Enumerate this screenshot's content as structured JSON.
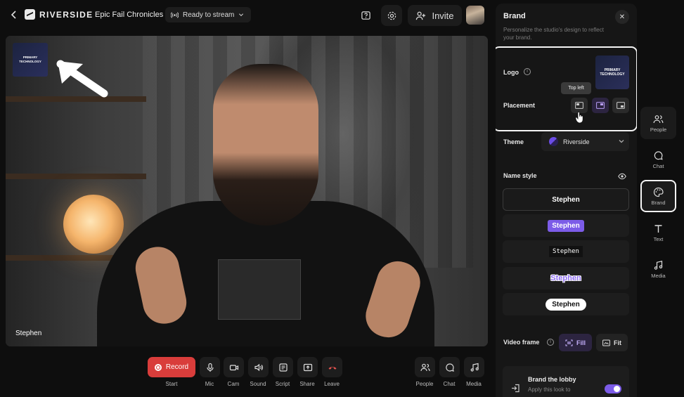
{
  "header": {
    "brand": "RIVERSIDE",
    "title": "Epic Fail Chronicles",
    "stream_status": "Ready to stream",
    "invite_label": "Invite"
  },
  "video": {
    "participant_name": "Stephen",
    "logo_overlay": [
      "PRIMARY",
      "TECHNOLOGY"
    ]
  },
  "controls": [
    {
      "label": "Start",
      "icon": "record-icon",
      "button_text": "Record"
    },
    {
      "label": "Mic",
      "icon": "microphone-icon"
    },
    {
      "label": "Cam",
      "icon": "camera-icon"
    },
    {
      "label": "Sound",
      "icon": "speaker-icon"
    },
    {
      "label": "Script",
      "icon": "script-icon"
    },
    {
      "label": "Share",
      "icon": "share-screen-icon"
    },
    {
      "label": "Leave",
      "icon": "hang-up-icon"
    },
    {
      "label": "People",
      "icon": "people-icon"
    },
    {
      "label": "Chat",
      "icon": "chat-icon"
    },
    {
      "label": "Media",
      "icon": "music-note-icon"
    }
  ],
  "brand_panel": {
    "title": "Brand",
    "subtitle": "Personalize the studio's design to reflect your brand.",
    "logo_label": "Logo",
    "logo_thumb": [
      "PRIMARY",
      "TECHNOLOGY"
    ],
    "placement_label": "Placement",
    "placement_tooltip": "Top left",
    "theme_label": "Theme",
    "theme_value": "Riverside",
    "name_style_label": "Name style",
    "name_styles": [
      "Stephen",
      "Stephen",
      "Stephen",
      "Stephen",
      "Stephen"
    ],
    "video_frame_label": "Video frame",
    "video_frame_fill": "Fill",
    "video_frame_fit": "Fit",
    "lobby_title": "Brand the lobby",
    "lobby_subtitle": "Apply this look to",
    "lobby_enabled": true
  },
  "rail": [
    {
      "label": "People",
      "icon": "people-icon"
    },
    {
      "label": "Chat",
      "icon": "chat-icon"
    },
    {
      "label": "Brand",
      "icon": "palette-icon",
      "active": true
    },
    {
      "label": "Text",
      "icon": "text-icon"
    },
    {
      "label": "Media",
      "icon": "music-note-icon"
    }
  ],
  "colors": {
    "record": "#d93d3b",
    "accent_purple": "#7c5ce8",
    "background": "#0e0e0e"
  }
}
